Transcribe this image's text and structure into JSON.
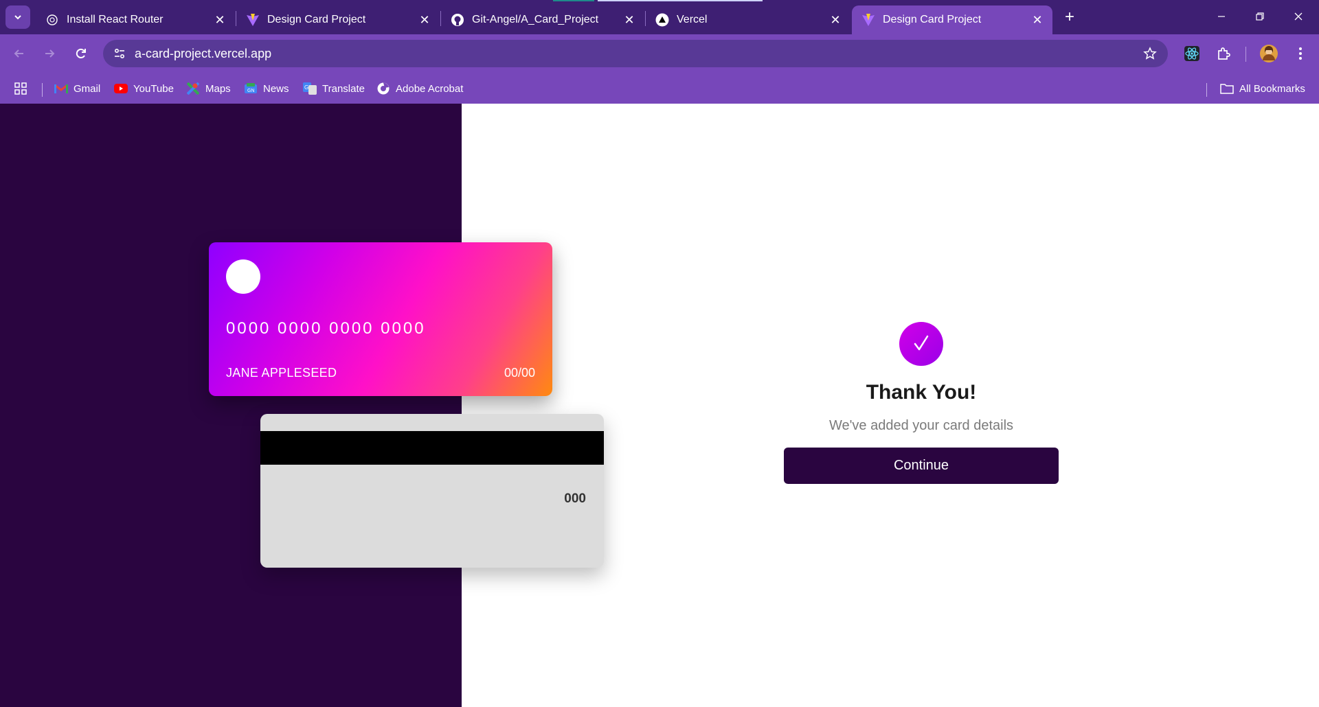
{
  "browser": {
    "tabs": [
      {
        "label": "Install React Router",
        "icon": "react-router-icon",
        "active": false
      },
      {
        "label": "Design Card Project",
        "icon": "vite-icon",
        "active": false
      },
      {
        "label": "Git-Angel/A_Card_Project",
        "icon": "github-icon",
        "active": false
      },
      {
        "label": "Vercel",
        "icon": "vercel-icon",
        "active": false
      },
      {
        "label": "Design Card Project",
        "icon": "vite-icon",
        "active": true
      }
    ],
    "close_glyph": "✕",
    "new_tab_glyph": "+",
    "address": "a-card-project.vercel.app",
    "bookmarks": [
      {
        "label": "Gmail",
        "icon": "gmail-icon"
      },
      {
        "label": "YouTube",
        "icon": "youtube-icon"
      },
      {
        "label": "Maps",
        "icon": "maps-icon"
      },
      {
        "label": "News",
        "icon": "news-icon"
      },
      {
        "label": "Translate",
        "icon": "translate-icon"
      },
      {
        "label": "Adobe Acrobat",
        "icon": "acrobat-icon"
      }
    ],
    "all_bookmarks": "All Bookmarks",
    "colors": {
      "tabstrip": "#3e1f73",
      "toolbar": "#7747ba",
      "omnibox": "#583996"
    }
  },
  "page": {
    "card_front": {
      "number": "0000 0000 0000 0000",
      "name": "JANE APPLESEED",
      "expiry": "00/00"
    },
    "card_back": {
      "cvc": "000"
    },
    "complete": {
      "title": "Thank You!",
      "subtitle": "We've added your card details",
      "button": "Continue"
    },
    "colors": {
      "left_panel": "#2a0540",
      "button": "#2a0540",
      "accent": "#d100e8"
    }
  }
}
